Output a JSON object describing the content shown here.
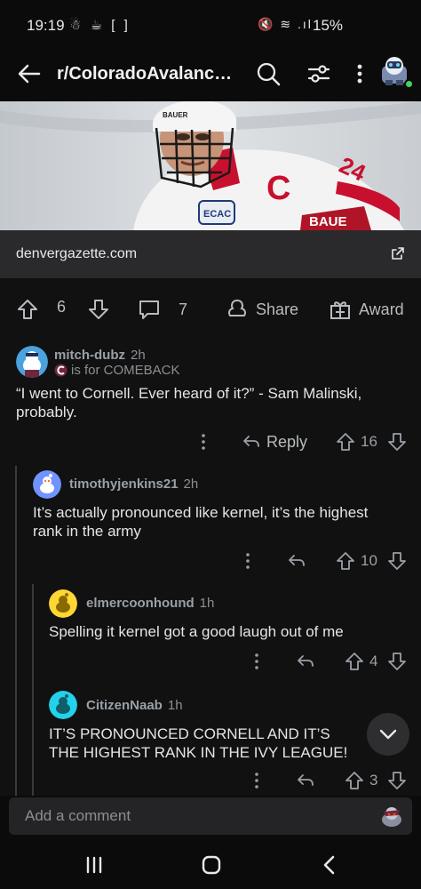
{
  "status_bar": {
    "time": "19:19",
    "left_icons": "☃ ☕ [ ]",
    "right_icons": "🔇 ≋ .ıl",
    "battery": "15%"
  },
  "header": {
    "title": "r/ColoradoAvalanc…",
    "icons": [
      "back-arrow-icon",
      "search-icon",
      "filter-icon",
      "more-vert-icon",
      "user-avatar"
    ]
  },
  "hero": {
    "jersey_number": "24",
    "captain_letter": "C",
    "helmet_brand": "BAUER",
    "patch_text": "ECAC",
    "glove_brand": "BAUE"
  },
  "link": {
    "domain": "denvergazette.com"
  },
  "post_actions": {
    "votes": "6",
    "comments": "7",
    "share_label": "Share",
    "award_label": "Award"
  },
  "comments": [
    {
      "user": "mitch-dubz",
      "age": "2h",
      "flair": "is for COMEBACK",
      "body": "“I went to Cornell. Ever heard of it?” - Sam Malinski, probably.",
      "reply_label": "Reply",
      "score": "16",
      "depth": 0
    },
    {
      "user": "timothyjenkins21",
      "age": "2h",
      "body": "It’s actually pronounced like kernel, it’s the highest rank in the army",
      "score": "10",
      "depth": 1
    },
    {
      "user": "elmercoonhound",
      "age": "1h",
      "body": "Spelling it kernel got a good laugh out of me",
      "score": "4",
      "depth": 2
    },
    {
      "user": "CitizenNaab",
      "age": "1h",
      "body": "IT’S PRONOUNCED CORNELL AND IT’S THE HIGHEST RANK IN THE IVY LEAGUE!",
      "score": "3",
      "depth": 2
    }
  ],
  "composer": {
    "placeholder": "Add a comment"
  },
  "colors": {
    "background": "#0b0b0b",
    "comment_bg": "#111112",
    "link_bar": "#2a2a2c",
    "avatar_blue": "#7193ff",
    "avatar_yellow": "#ffd635",
    "avatar_cyan": "#24d1ea",
    "online_green": "#46d160"
  }
}
